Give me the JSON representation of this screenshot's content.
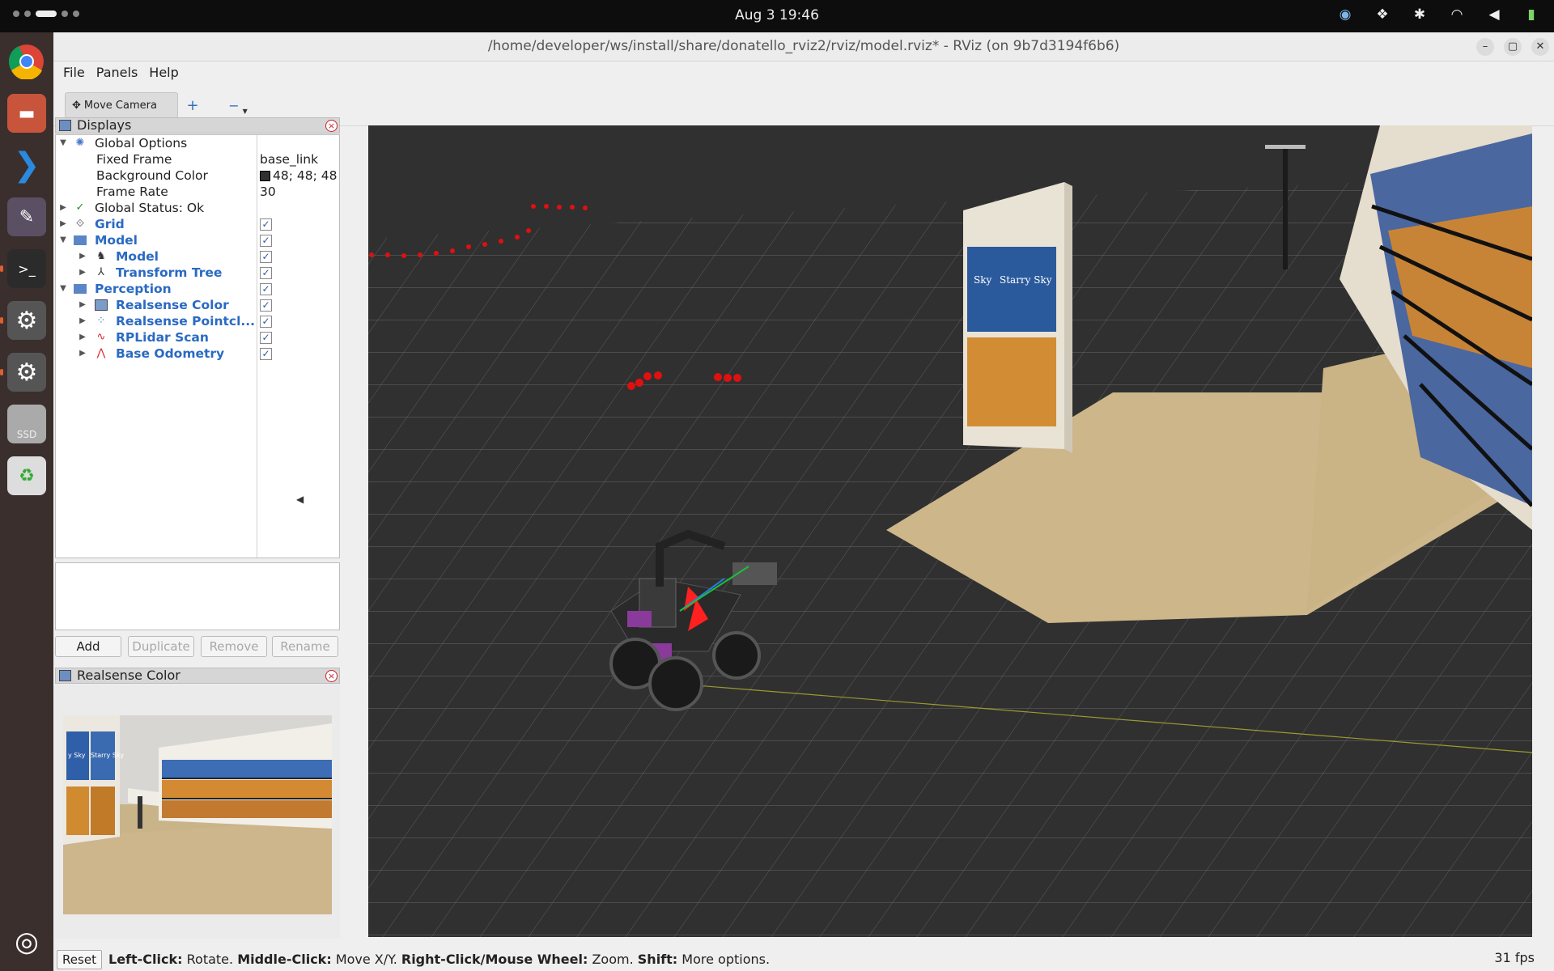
{
  "topbar": {
    "clock": "Aug 3  19:46",
    "tray_icons": [
      "sync-icon",
      "dropbox-icon",
      "accessibility-icon",
      "wifi-icon",
      "volume-icon",
      "battery-icon"
    ]
  },
  "dock": {
    "items": [
      "chrome-icon",
      "files-icon",
      "vscode-icon",
      "text-editor-icon",
      "terminal-icon",
      "settings-icon",
      "settings-alt-icon",
      "ssd-drive-icon",
      "trash-icon",
      "ubuntu-apps-icon"
    ],
    "ssd_label": "SSD"
  },
  "window": {
    "title": "/home/developer/ws/install/share/donatello_rviz2/rviz/model.rviz* - RViz (on 9b7d3194f6b6)"
  },
  "menu": {
    "file": "File",
    "panels": "Panels",
    "help": "Help"
  },
  "toolbar": {
    "move_camera": "Move Camera",
    "add_icon": "+",
    "remove_icon": "−"
  },
  "displays": {
    "title": "Displays",
    "global_options": {
      "label": "Global Options",
      "fixed_frame_label": "Fixed Frame",
      "fixed_frame_value": "base_link",
      "bg_color_label": "Background Color",
      "bg_color_value": "48; 48; 48",
      "bg_color_hex": "#303030",
      "frame_rate_label": "Frame Rate",
      "frame_rate_value": "30"
    },
    "global_status": "Global Status: Ok",
    "items": {
      "grid": "Grid",
      "model_group": "Model",
      "model": "Model",
      "transform_tree": "Transform Tree",
      "perception": "Perception",
      "realsense_color": "Realsense Color",
      "realsense_pointcloud": "Realsense Pointcl...",
      "rplidar_scan": "RPLidar Scan",
      "base_odometry": "Base Odometry"
    },
    "checked": "✓"
  },
  "buttons": {
    "add": "Add",
    "duplicate": "Duplicate",
    "remove": "Remove",
    "rename": "Rename"
  },
  "realsense_panel": {
    "title": "Realsense Color",
    "poster_text_1": "y Sky",
    "poster_text_2": "Starry Sky"
  },
  "viewport": {
    "poster_text_1": "Sky",
    "poster_text_2": "Starry Sky"
  },
  "status": {
    "reset": "Reset",
    "left_click": "Left-Click:",
    "rotate": "Rotate.",
    "middle_click": "Middle-Click:",
    "move_xy": "Move X/Y.",
    "right_click": "Right-Click/Mouse Wheel:",
    "zoom": "Zoom.",
    "shift": "Shift:",
    "more": "More options.",
    "fps": "31 fps"
  }
}
